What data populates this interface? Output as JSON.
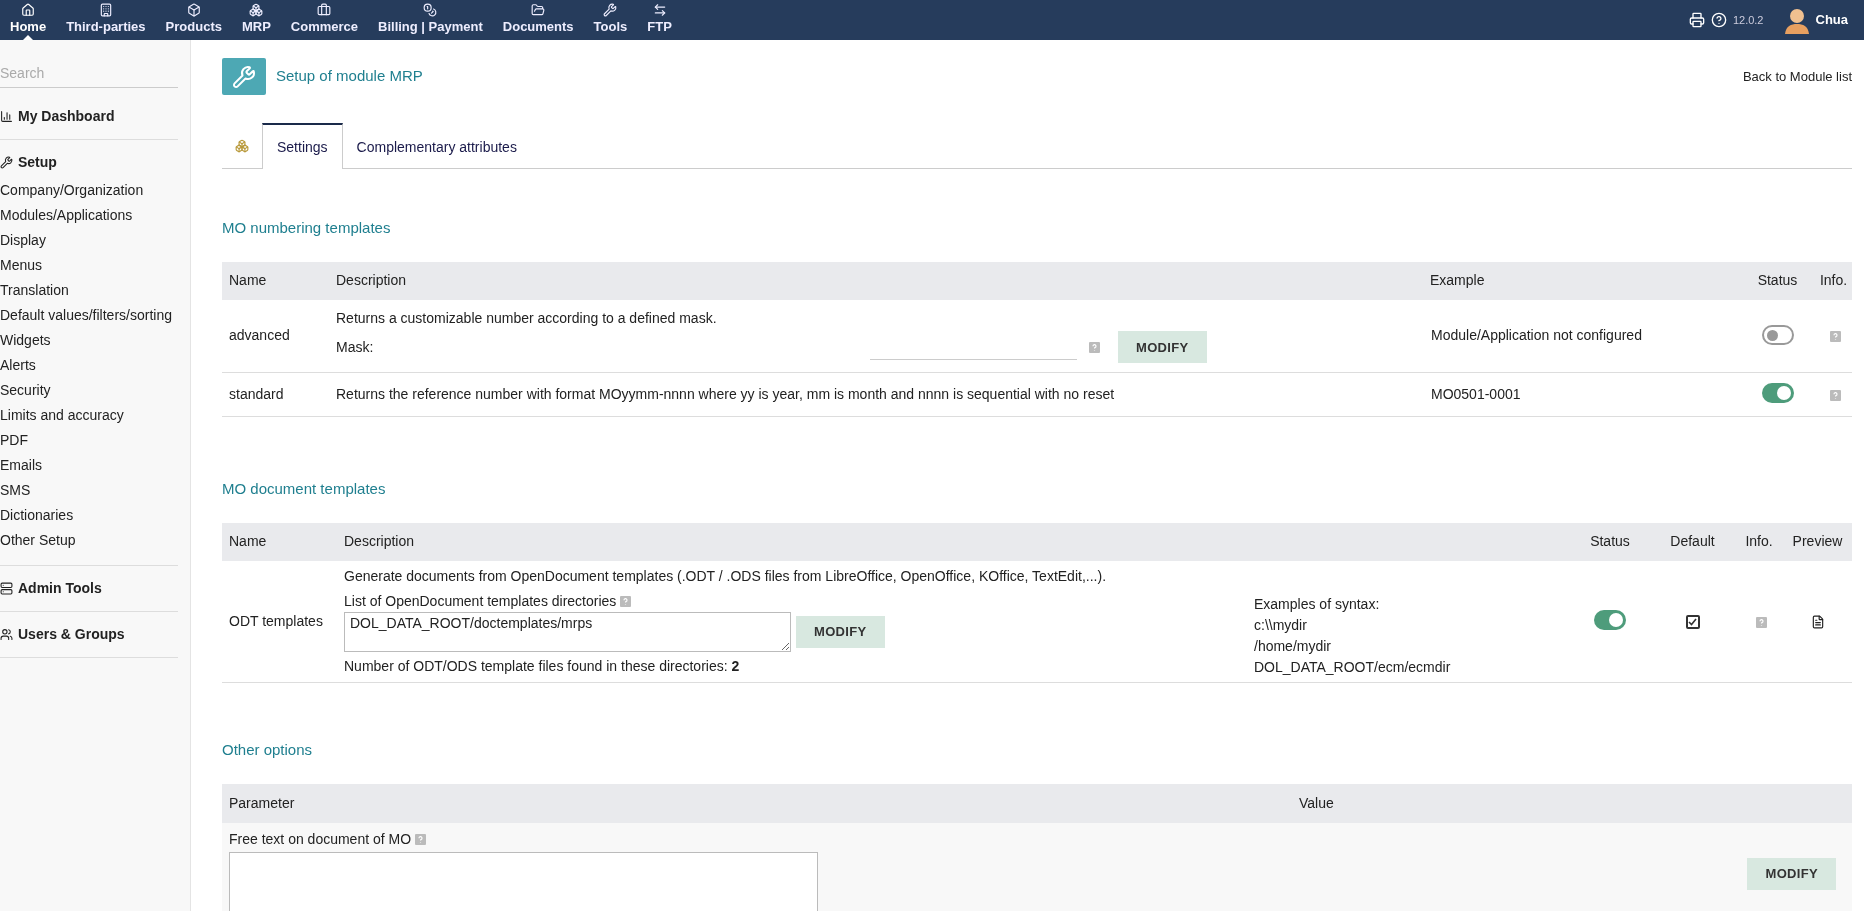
{
  "topnav": {
    "items": [
      {
        "label": "Home",
        "selected": true
      },
      {
        "label": "Third-parties",
        "selected": false
      },
      {
        "label": "Products",
        "selected": false
      },
      {
        "label": "MRP",
        "selected": false
      },
      {
        "label": "Commerce",
        "selected": false
      },
      {
        "label": "Billing | Payment",
        "selected": false
      },
      {
        "label": "Documents",
        "selected": false
      },
      {
        "label": "Tools",
        "selected": false
      },
      {
        "label": "FTP",
        "selected": false
      }
    ],
    "version": "12.0.2",
    "user": "Chua"
  },
  "sidebar": {
    "search": {
      "placeholder": "Search"
    },
    "sections": [
      {
        "title": "My Dashboard"
      },
      {
        "title": "Setup",
        "items": [
          "Company/Organization",
          "Modules/Applications",
          "Display",
          "Menus",
          "Translation",
          "Default values/filters/sorting",
          "Widgets",
          "Alerts",
          "Security",
          "Limits and accuracy",
          "PDF",
          "Emails",
          "SMS",
          "Dictionaries",
          "Other Setup"
        ]
      },
      {
        "title": "Admin Tools"
      },
      {
        "title": "Users & Groups"
      }
    ]
  },
  "page": {
    "title": "Setup of module MRP",
    "back_link": "Back to Module list",
    "tabs": [
      {
        "label": "Settings",
        "selected": true
      },
      {
        "label": "Complementary attributes",
        "selected": false
      }
    ]
  },
  "numbering": {
    "heading": "MO numbering templates",
    "columns": [
      "Name",
      "Description",
      "Example",
      "Status",
      "Info."
    ],
    "rows": [
      {
        "kind": "mask",
        "name": "advanced",
        "description": "Returns a customizable number according to a defined mask.",
        "mask_label": "Mask:",
        "button": "MODIFY",
        "example": "Module/Application not configured",
        "on": false
      },
      {
        "kind": "plain",
        "name": "standard",
        "description": "Returns the reference number with format MOyymm-nnnn where yy is year, mm is month and nnnn is sequential with no reset",
        "example": "MO0501-0001",
        "on": true
      }
    ]
  },
  "documents": {
    "heading": "MO document templates",
    "columns": [
      "Name",
      "Description",
      "Status",
      "Default",
      "Info.",
      "Preview"
    ],
    "rows": [
      {
        "name": "ODT templates",
        "description": "Generate documents from OpenDocument templates (.ODT / .ODS files from LibreOffice, OpenOffice, KOffice, TextEdit,...).",
        "dirs_label": "List of OpenDocument templates directories",
        "dirs_value": "DOL_DATA_ROOT/doctemplates/mrps",
        "button": "MODIFY",
        "count_label": "Number of ODT/ODS template files found in these directories: **2**",
        "syntax_lines": [
          "Examples of syntax:",
          "c:\\\\mydir",
          "/home/mydir",
          "DOL_DATA_ROOT/ecm/ecmdir"
        ],
        "on": true,
        "default": true
      }
    ]
  },
  "options": {
    "heading": "Other options",
    "columns": [
      "Parameter",
      "Value"
    ],
    "rows": [
      {
        "label": "Free text on document of MO",
        "button": "MODIFY"
      }
    ]
  }
}
